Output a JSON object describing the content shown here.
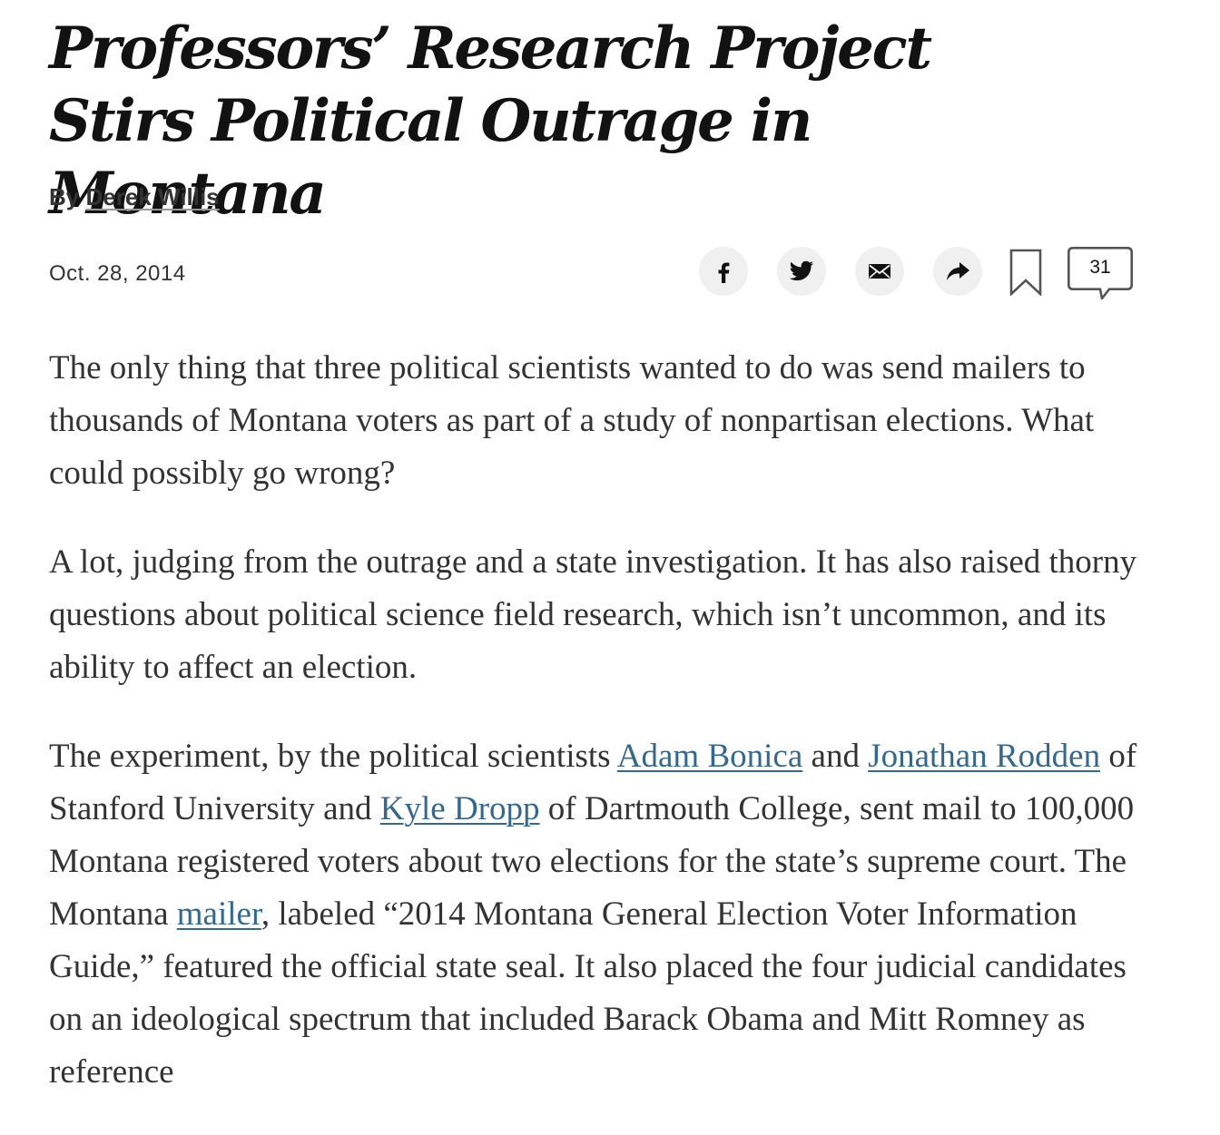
{
  "article": {
    "headline": "Professors’ Research Project Stirs Political Outrage in Montana",
    "byline_prefix": "By ",
    "author": "Derek Willis",
    "date": "Oct. 28, 2014",
    "comment_count": "31"
  },
  "share": {
    "icons": [
      "facebook-icon",
      "twitter-icon",
      "email-icon",
      "share-arrow-icon",
      "bookmark-icon",
      "comments-icon"
    ]
  },
  "paragraphs": {
    "p1": "The only thing that three political scientists wanted to do was send mailers to thousands of Montana voters as part of a study of nonpartisan elections. What could possibly go wrong?",
    "p2": "A lot, judging from the outrage and a state investigation. It has also raised thorny questions about political science field research, which isn’t uncommon, and its ability to affect an election.",
    "p3": {
      "t1": "The experiment, by the political scientists ",
      "link1": "Adam Bonica",
      "t2": " and ",
      "link2": "Jonathan Rodden",
      "t3": " of Stanford University and ",
      "link3": "Kyle Dropp",
      "t4": " of Dartmouth College, sent mail to 100,000 Montana registered voters about two elections for the state’s supreme court. The Montana ",
      "link4": "mailer",
      "t5": ", labeled “2014 Montana General Election Voter Information Guide,” featured the official state seal. It also placed the four judicial candidates on an ideological spectrum that included Barack Obama and Mitt Romney as reference"
    }
  },
  "colors": {
    "link": "#326891",
    "body_text": "#333333",
    "headline": "#121212",
    "share_button_bg": "#f0f0f0"
  }
}
